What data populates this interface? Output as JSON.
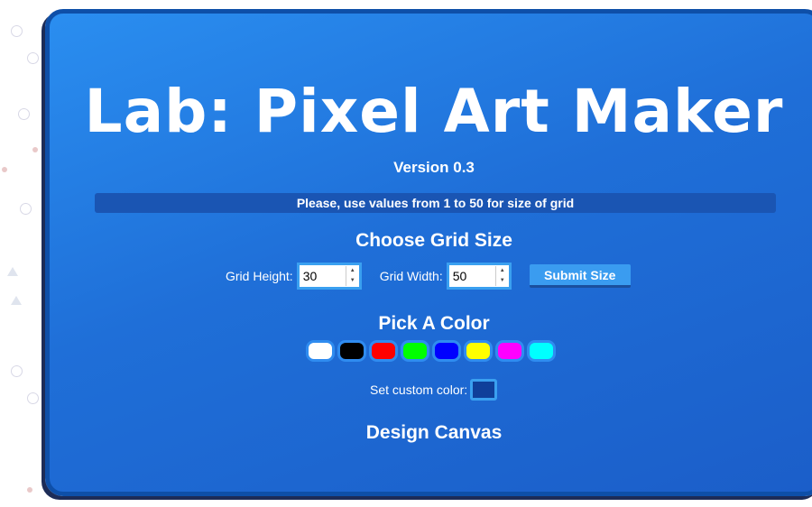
{
  "title": "Lab: Pixel Art Maker",
  "version": "Version 0.3",
  "notice": "Please, use values from 1 to 50 for size of grid",
  "grid_section": {
    "heading": "Choose Grid Size",
    "height_label": "Grid Height:",
    "height_value": "30",
    "width_label": "Grid Width:",
    "width_value": "50",
    "submit_label": "Submit Size"
  },
  "color_section": {
    "heading": "Pick A Color",
    "swatches": [
      "#ffffff",
      "#000000",
      "#ff0000",
      "#00ff00",
      "#0000ff",
      "#ffff00",
      "#ff00ff",
      "#00ffff"
    ],
    "custom_label": "Set custom color:",
    "custom_value": "#0f3f9a"
  },
  "canvas_section": {
    "heading": "Design Canvas"
  }
}
